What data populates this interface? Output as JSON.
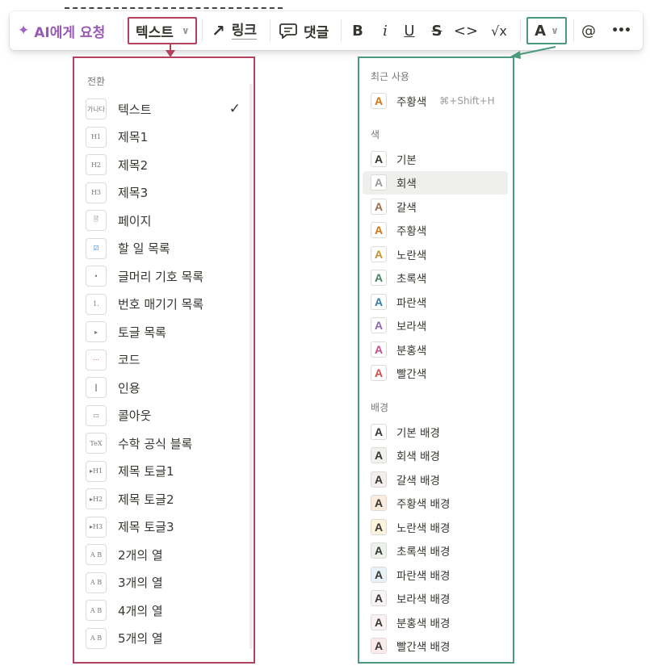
{
  "toolbar": {
    "ai_label": "AI에게 요청",
    "turn_into_label": "텍스트",
    "link_label": "링크",
    "comment_label": "댓글",
    "bold": "B",
    "italic": "i",
    "underline": "U",
    "strikethrough": "S",
    "code": "<>",
    "math": "√x",
    "color_label": "A",
    "mention": "@",
    "more": "•••"
  },
  "turn_into_menu": {
    "section_label": "전환",
    "items": [
      {
        "label": "텍스트",
        "icon": "text-icon",
        "thumb": "가나다",
        "selected": true
      },
      {
        "label": "제목1",
        "icon": "heading1-icon",
        "thumb": "H1"
      },
      {
        "label": "제목2",
        "icon": "heading2-icon",
        "thumb": "H2"
      },
      {
        "label": "제목3",
        "icon": "heading3-icon",
        "thumb": "H3"
      },
      {
        "label": "페이지",
        "icon": "page-icon",
        "thumb": "🗎"
      },
      {
        "label": "할 일 목록",
        "icon": "todo-icon",
        "thumb": "☑"
      },
      {
        "label": "글머리 기호 목록",
        "icon": "bullet-list-icon",
        "thumb": "•"
      },
      {
        "label": "번호 매기기 목록",
        "icon": "numbered-list-icon",
        "thumb": "1."
      },
      {
        "label": "토글 목록",
        "icon": "toggle-list-icon",
        "thumb": "▸"
      },
      {
        "label": "코드",
        "icon": "code-icon",
        "thumb": "⋯"
      },
      {
        "label": "인용",
        "icon": "quote-icon",
        "thumb": "┃"
      },
      {
        "label": "콜아웃",
        "icon": "callout-icon",
        "thumb": "▭"
      },
      {
        "label": "수학 공식 블록",
        "icon": "math-block-icon",
        "thumb": "TeX"
      },
      {
        "label": "제목 토글1",
        "icon": "toggle-heading1-icon",
        "thumb": "▸H1"
      },
      {
        "label": "제목 토글2",
        "icon": "toggle-heading2-icon",
        "thumb": "▸H2"
      },
      {
        "label": "제목 토글3",
        "icon": "toggle-heading3-icon",
        "thumb": "▸H3"
      },
      {
        "label": "2개의 열",
        "icon": "columns2-icon",
        "thumb": "A B"
      },
      {
        "label": "3개의 열",
        "icon": "columns3-icon",
        "thumb": "A B"
      },
      {
        "label": "4개의 열",
        "icon": "columns4-icon",
        "thumb": "A B"
      },
      {
        "label": "5개의 열",
        "icon": "columns5-icon",
        "thumb": "A B"
      }
    ]
  },
  "color_menu": {
    "recent_label": "최근 사용",
    "recent_items": [
      {
        "label": "주황색",
        "shortcut": "⌘+Shift+H",
        "color": "#d9730d",
        "bg": "#ffffff"
      }
    ],
    "text_color_label": "색",
    "text_colors": [
      {
        "label": "기본",
        "color": "#37352f",
        "bg": "#ffffff"
      },
      {
        "label": "회색",
        "color": "#9b9a97",
        "bg": "#ffffff"
      },
      {
        "label": "갈색",
        "color": "#9f6b53",
        "bg": "#ffffff"
      },
      {
        "label": "주황색",
        "color": "#d9730d",
        "bg": "#ffffff"
      },
      {
        "label": "노란색",
        "color": "#cb912f",
        "bg": "#ffffff"
      },
      {
        "label": "초록색",
        "color": "#448361",
        "bg": "#ffffff"
      },
      {
        "label": "파란색",
        "color": "#337ea9",
        "bg": "#ffffff"
      },
      {
        "label": "보라색",
        "color": "#9065b0",
        "bg": "#ffffff"
      },
      {
        "label": "분홍색",
        "color": "#c14c8a",
        "bg": "#ffffff"
      },
      {
        "label": "빨간색",
        "color": "#d44c47",
        "bg": "#ffffff"
      }
    ],
    "background_label": "배경",
    "background_colors": [
      {
        "label": "기본 배경",
        "color": "#37352f",
        "bg": "#ffffff"
      },
      {
        "label": "회색 배경",
        "color": "#37352f",
        "bg": "#f1f1ef"
      },
      {
        "label": "갈색 배경",
        "color": "#37352f",
        "bg": "#f4eeee"
      },
      {
        "label": "주황색 배경",
        "color": "#37352f",
        "bg": "#fbecdd"
      },
      {
        "label": "노란색 배경",
        "color": "#37352f",
        "bg": "#fbf3db"
      },
      {
        "label": "초록색 배경",
        "color": "#37352f",
        "bg": "#edf3ec"
      },
      {
        "label": "파란색 배경",
        "color": "#37352f",
        "bg": "#e7f3f8"
      },
      {
        "label": "보라색 배경",
        "color": "#37352f",
        "bg": "#f6f3f9"
      },
      {
        "label": "분홍색 배경",
        "color": "#37352f",
        "bg": "#faf1f5"
      },
      {
        "label": "빨간색 배경",
        "color": "#37352f",
        "bg": "#fdebec"
      }
    ]
  }
}
